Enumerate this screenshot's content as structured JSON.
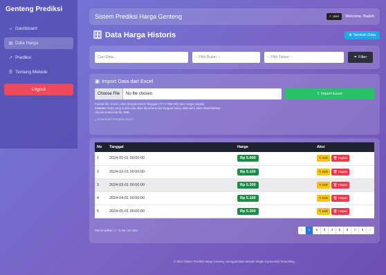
{
  "sidebar": {
    "brand": "Genteng Prediksi",
    "items": [
      {
        "icon": "⌂",
        "label": "Dashboard"
      },
      {
        "icon": "▤",
        "label": "Data Harga"
      },
      {
        "icon": "↗",
        "label": "Prediksi"
      },
      {
        "icon": "☰",
        "label": "Tentang Metode"
      }
    ],
    "logout": "Logout"
  },
  "topbar": {
    "title": "Sistem Prediksi Harga Genteng",
    "user_chip": "✓ User",
    "welcome": "Welcome, Badeh"
  },
  "page": {
    "title": "Data Harga Historis",
    "add_button": "⊕ Tambah Data"
  },
  "filter": {
    "search_value": "Cari Data...",
    "bulan_placeholder": "-- Pilih Bulan --",
    "tahun_placeholder": "-- Pilih Tahun --",
    "filter_button": "Filter"
  },
  "import": {
    "title": "Import Data dari Excel",
    "choose_label": "Choose File",
    "no_file_label": "No file chosen",
    "import_button": "Import Excel",
    "note_line1": "Format file: Excel (.xlsx) dengan kolom Tanggal (YYYY-MM-DD) dan Harga (angka).",
    "note_label": "Catatan:",
    "note_line2": "Data yang sudah ada akan diperbarui jika tanggal sama, data baru akan ditambahkan.",
    "note_line3": "Ukuran maksimal file 2MB.",
    "template_link": "Download Template Excel"
  },
  "table": {
    "columns": [
      "No",
      "Tanggal",
      "Harga",
      "Aksi"
    ],
    "rows": [
      {
        "no": "1",
        "date": "2024-01-01 00:00:00",
        "price": "Rp 5.000"
      },
      {
        "no": "2",
        "date": "2024-02-01 00:00:00",
        "price": "Rp 5.100"
      },
      {
        "no": "3",
        "date": "2024-03-01 00:00:00",
        "price": "Rp 5.200"
      },
      {
        "no": "4",
        "date": "2024-04-01 00:00:00",
        "price": "Rp 5.150"
      },
      {
        "no": "5",
        "date": "2024-05-01 00:00:00",
        "price": "Rp 5.300"
      }
    ],
    "edit_label": "✎ Edit",
    "delete_label": "🗑 Hapus",
    "count_text": "Menampilkan 1 - 5 dari 36 data",
    "pages": [
      "‹",
      "1",
      "2",
      "3",
      "4",
      "5",
      "6",
      "7",
      "8",
      "›"
    ],
    "active_page": "1"
  },
  "footer": {
    "text": "© 2024 Sistem Prediksi Harga Genteng. Menggunakan Metode Single Exponential Smoothing."
  }
}
